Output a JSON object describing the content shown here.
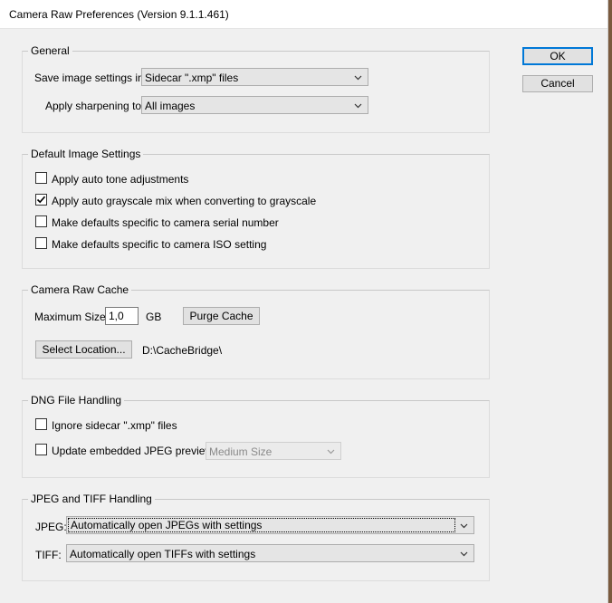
{
  "window": {
    "title": "Camera Raw Preferences  (Version 9.1.1.461)"
  },
  "buttons": {
    "ok": "OK",
    "cancel": "Cancel"
  },
  "general": {
    "legend": "General",
    "save_settings_label": "Save image settings in:",
    "save_settings_value": "Sidecar \".xmp\" files",
    "sharpening_label": "Apply sharpening to:",
    "sharpening_value": "All images"
  },
  "default_image": {
    "legend": "Default Image Settings",
    "options": [
      {
        "label": "Apply auto tone adjustments",
        "checked": false
      },
      {
        "label": "Apply auto grayscale mix when converting to grayscale",
        "checked": true
      },
      {
        "label": "Make defaults specific to camera serial number",
        "checked": false
      },
      {
        "label": "Make defaults specific to camera ISO setting",
        "checked": false
      }
    ]
  },
  "cache": {
    "legend": "Camera Raw Cache",
    "max_size_label": "Maximum Size:",
    "max_size_value": "1,0",
    "unit": "GB",
    "purge_button": "Purge Cache",
    "select_location_button": "Select Location...",
    "location_path": "D:\\CacheBridge\\"
  },
  "dng": {
    "legend": "DNG File Handling",
    "ignore_sidecar_label": "Ignore sidecar \".xmp\" files",
    "ignore_sidecar_checked": false,
    "update_previews_label": "Update embedded JPEG previews:",
    "update_previews_checked": false,
    "preview_size_value": "Medium Size"
  },
  "jpeg_tiff": {
    "legend": "JPEG and TIFF Handling",
    "jpeg_label": "JPEG:",
    "jpeg_value": "Automatically open JPEGs with settings",
    "tiff_label": "TIFF:",
    "tiff_value": "Automatically open TIFFs with settings"
  }
}
